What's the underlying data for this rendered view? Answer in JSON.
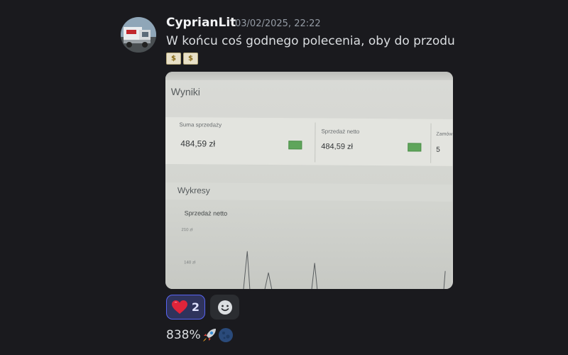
{
  "message": {
    "author": "CyprianLit",
    "timestamp": "03/02/2025, 22:22",
    "text": "W końcu coś godnego polecenia, oby do przodu",
    "emojis": [
      "money-bag-emoji",
      "money-bag-emoji"
    ],
    "avatar": "truck-avatar"
  },
  "attachment": {
    "type": "photo-of-screen",
    "section_title": "Wyniki",
    "cards": [
      {
        "label": "Suma sprzedaży",
        "value": "484,59 zł"
      },
      {
        "label": "Sprzedaż netto",
        "value": "484,59 zł"
      },
      {
        "label": "Zamów",
        "value": "5"
      }
    ],
    "charts_title": "Wykresy",
    "chart_title": "Sprzedaż netto",
    "y_ticks": [
      "210 zł",
      "140 zł"
    ]
  },
  "reactions": [
    {
      "emoji": "red-heart-emoji",
      "count": "2",
      "selected": true
    },
    {
      "emoji": "add-reaction-icon"
    }
  ],
  "follow_up": {
    "text": "838%",
    "emojis": [
      "rocket-emoji",
      "moon-emoji"
    ]
  },
  "colors": {
    "background": "#1a1a1e",
    "username": "#f2f3f5",
    "timestamp": "#949ba4",
    "reaction_selected_bg": "#2f335c",
    "reaction_selected_border": "#5865f2",
    "badge_green": "#5fa55b"
  }
}
